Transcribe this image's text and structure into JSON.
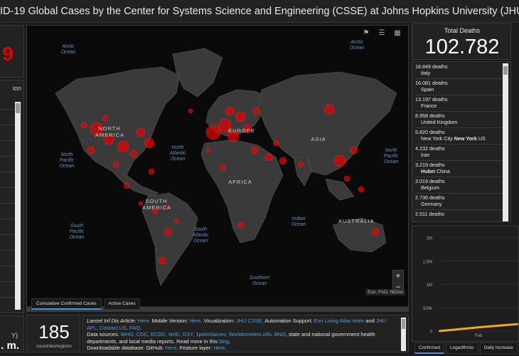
{
  "title": "ID-19 Global Cases by the Center for Systems Science and Engineering (CSSE) at Johns Hopkins University (JHU)",
  "left": {
    "total_fragment": "9",
    "list_header_fragment": "ion",
    "bottom_fragment_1": "Y)",
    "bottom_fragment_2": ". m."
  },
  "map": {
    "tools": [
      "bookmark-icon",
      "list-icon",
      "grid-icon"
    ],
    "oceans": {
      "arctic_w": "Arctic\nOcean",
      "arctic_e": "Arctic\nOcean",
      "north_pacific_w": "North\nPacific\nOcean",
      "north_atlantic": "North\nAtlantic\nOcean",
      "north_pacific_e": "North\nPacific\nOcean",
      "south_pacific": "South\nPacific\nOcean",
      "south_atlantic": "South\nAtlantic\nOcean",
      "indian": "Indian\nOcean",
      "southern": "Southern\nOcean"
    },
    "continents": {
      "north_america": "NORTH\nAMERICA",
      "south_america": "SOUTH\nAMERICA",
      "europe": "EUROPE",
      "asia": "ASIA",
      "africa": "AFRICA",
      "australia": "AUSTRALIA"
    },
    "zoom_in": "+",
    "zoom_out": "−",
    "attribution": "Esri, FAO, NOAA",
    "tabs": [
      "Cumulative Confirmed Cases",
      "Active Cases"
    ],
    "accent": "#e60000"
  },
  "countries": {
    "count": "185",
    "label": "countries/regions"
  },
  "info": {
    "l1_a": "Lancet Inf Dis Article: ",
    "l1_here1": "Here",
    "l1_b": ". Mobile Version: ",
    "l1_here2": "Here",
    "l1_c": ". Visualization: ",
    "l1_jhu": "JHU CSSE",
    "l1_d": ". Automation Support: ",
    "l1_esri": "Esri Living Atlas team",
    "l1_e": " and ",
    "l1_jhu2": "JHU",
    "l2_apl": "APL",
    "l2_a": ". ",
    "l2_contact": "Contact US",
    "l2_b": ". ",
    "l2_faq": "FAQ",
    "l2_c": ".",
    "l3_a": "Data sources: ",
    "l3_links": "WHO, CDC, ECDC, NHC, DXY, 1point3acres, Worldometers.info, BNO",
    "l3_b": ", state and national government health",
    "l4_a": "departments, and local media reports.  Read more in this ",
    "l4_blog": "blog",
    "l4_b": ".",
    "l5_a": "Downloadable database: GitHub: ",
    "l5_here": "Here",
    "l5_b": ". Feature layer: ",
    "l5_here2": "Here",
    "l5_c": "."
  },
  "deaths": {
    "title": "Total Deaths",
    "total": "102.782",
    "rows": [
      {
        "value": "18.849 deaths",
        "country": "Italy"
      },
      {
        "value": "16.081 deaths",
        "country": "Spain"
      },
      {
        "value": "13.197 deaths",
        "country": "France"
      },
      {
        "value": "8.958 deaths",
        "country": "United Kingdom"
      },
      {
        "value": "5.820 deaths",
        "country_pre": "New York City ",
        "country_bold": "New York",
        "country_post": " US"
      },
      {
        "value": "4.232 deaths",
        "country": "Iran"
      },
      {
        "value": "3.219 deaths",
        "country_pre": "",
        "country_bold": "Hubei",
        "country_post": " China"
      },
      {
        "value": "3.019 deaths",
        "country": "Belgium"
      },
      {
        "value": "2.736 deaths",
        "country": "Germany"
      },
      {
        "value": "2.511 deaths",
        "country": ""
      }
    ]
  },
  "chart": {
    "tabs": [
      "Confirmed",
      "Logarithmic",
      "Daily Increase"
    ],
    "line_color": "#f5a623"
  },
  "chart_data": {
    "type": "line",
    "categories": [
      "",
      "Feb",
      ""
    ],
    "yticks": [
      "0",
      "500k",
      "1M",
      "1.5M",
      "2M"
    ],
    "ylim": [
      0,
      2000000
    ],
    "series": [
      {
        "values": [
          0,
          80000,
          150000
        ]
      }
    ],
    "xlabel": "",
    "ylabel": "",
    "title": ""
  }
}
